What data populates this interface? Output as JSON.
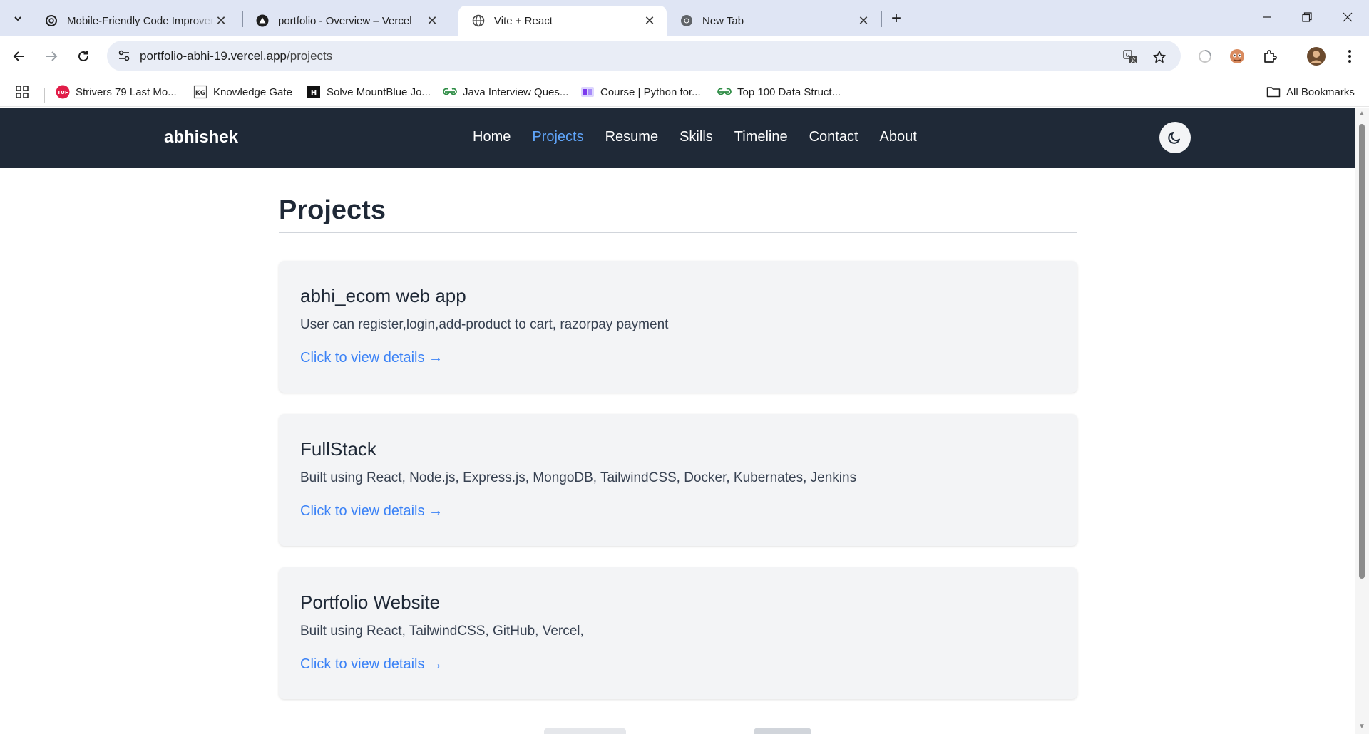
{
  "browser": {
    "tabs": [
      {
        "title": "Mobile-Friendly Code Improver",
        "icon": "openai-icon"
      },
      {
        "title": "portfolio - Overview – Vercel",
        "icon": "vercel-icon"
      },
      {
        "title": "Vite + React",
        "icon": "globe-icon",
        "active": true
      },
      {
        "title": "New Tab",
        "icon": "chrome-icon"
      }
    ],
    "url_host": "portfolio-abhi-19.vercel.app",
    "url_path": "/projects",
    "bookmarks": [
      {
        "label": "Strivers 79 Last Mo...",
        "icon_text": "TUF",
        "color": "#e11d48"
      },
      {
        "label": "Knowledge Gate",
        "icon_text": "KG",
        "color": "#6b7280"
      },
      {
        "label": "Solve MountBlue Jo...",
        "icon_text": "H",
        "color": "#111111"
      },
      {
        "label": "Java Interview Ques...",
        "icon_text": "GG",
        "color": "#2f8d46"
      },
      {
        "label": "Course | Python for...",
        "icon_text": "C",
        "color": "#7c3aed"
      },
      {
        "label": "Top 100 Data Struct...",
        "icon_text": "GG",
        "color": "#2f8d46"
      }
    ],
    "all_bookmarks": "All Bookmarks"
  },
  "site": {
    "brand": "abhishek",
    "nav": [
      "Home",
      "Projects",
      "Resume",
      "Skills",
      "Timeline",
      "Contact",
      "About"
    ],
    "active_nav": "Projects",
    "theme_toggle_icon": "moon-icon"
  },
  "main": {
    "heading": "Projects",
    "projects": [
      {
        "title": "abhi_ecom web app",
        "description": "User can register,login,add-product to cart, razorpay payment",
        "link": "Click to view details →"
      },
      {
        "title": "FullStack",
        "description": "Built using React, Node.js, Express.js, MongoDB, TailwindCSS, Docker, Kubernates, Jenkins",
        "link": "Click to view details →"
      },
      {
        "title": "Portfolio Website",
        "description": "Built using React, TailwindCSS, GitHub, Vercel,",
        "link": "Click to view details →"
      }
    ]
  },
  "colors": {
    "navbar_bg": "#1f2937",
    "active_nav": "#60a5fa",
    "link": "#3b82f6",
    "card_bg": "#f3f4f6"
  }
}
